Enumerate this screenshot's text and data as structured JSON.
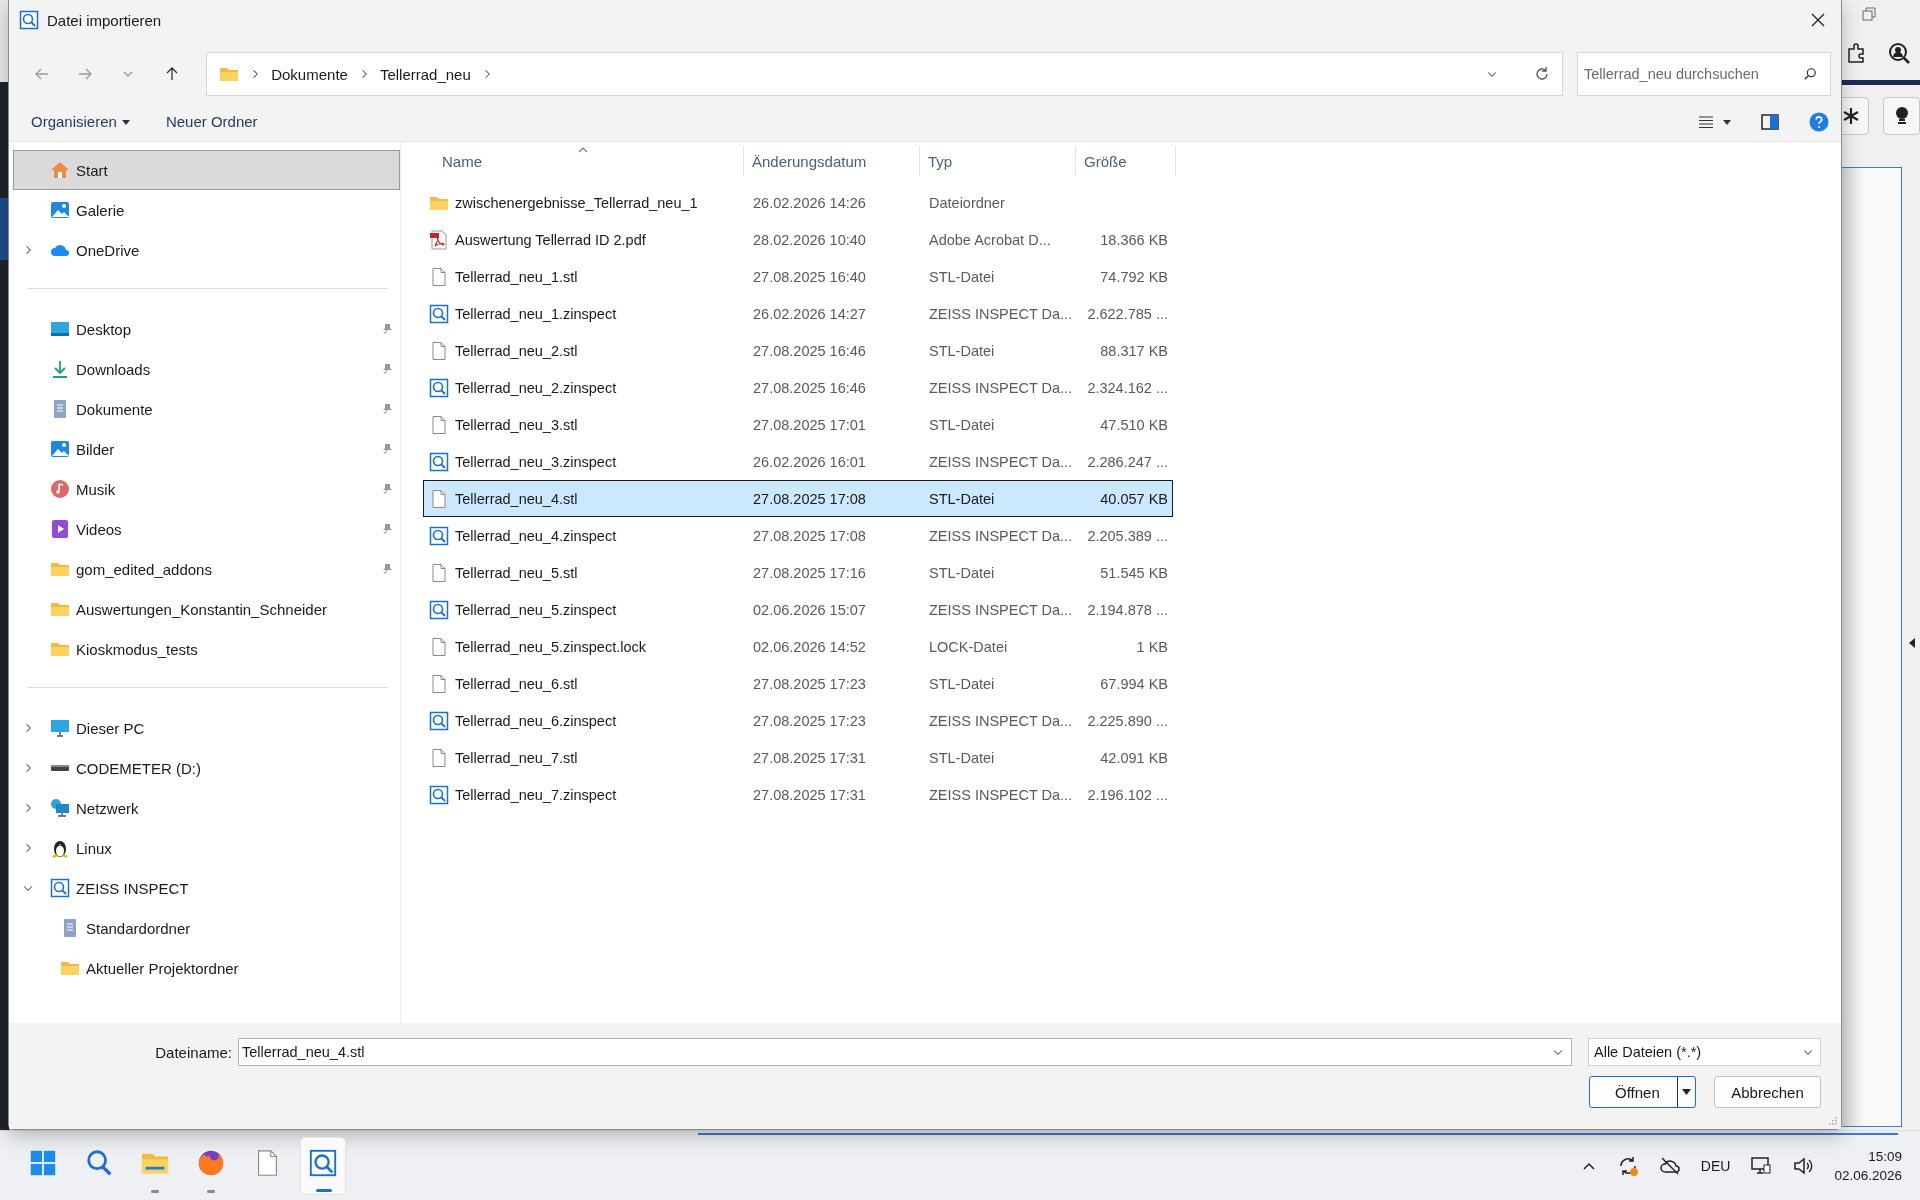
{
  "window": {
    "title": "Datei importieren"
  },
  "address": {
    "path": [
      "Dokumente",
      "Tellerrad_neu"
    ]
  },
  "search": {
    "placeholder": "Tellerrad_neu durchsuchen"
  },
  "commands": [
    {
      "label": "Organisieren",
      "dropdown": true
    },
    {
      "label": "Neuer Ordner",
      "dropdown": false
    }
  ],
  "sidebar": {
    "groups": [
      {
        "items": [
          {
            "label": "Start",
            "kind": "home",
            "selected": true
          },
          {
            "label": "Galerie",
            "kind": "gallery",
            "selected": false
          },
          {
            "label": "OneDrive",
            "kind": "cloud",
            "selected": false,
            "expanded": false
          }
        ]
      },
      {
        "items": [
          {
            "label": "Desktop",
            "kind": "desktop",
            "selected": false,
            "pinned": true
          },
          {
            "label": "Downloads",
            "kind": "download",
            "selected": false,
            "pinned": true
          },
          {
            "label": "Dokumente",
            "kind": "document",
            "selected": false,
            "pinned": true
          },
          {
            "label": "Bilder",
            "kind": "gallery",
            "selected": false,
            "pinned": true
          },
          {
            "label": "Musik",
            "kind": "music",
            "selected": false,
            "pinned": true
          },
          {
            "label": "Videos",
            "kind": "video",
            "selected": false,
            "pinned": true
          },
          {
            "label": "gom_edited_addons",
            "kind": "folder",
            "selected": false,
            "pinned": true
          },
          {
            "label": "Auswertungen_Konstantin_Schneider",
            "kind": "folder",
            "selected": false,
            "pinned": false
          },
          {
            "label": "Kioskmodus_tests",
            "kind": "folder",
            "selected": false,
            "pinned": false
          }
        ]
      },
      {
        "items": [
          {
            "label": "Dieser PC",
            "kind": "pc",
            "selected": false,
            "expanded": false
          },
          {
            "label": "CODEMETER (D:)",
            "kind": "drive",
            "selected": false,
            "expanded": false
          },
          {
            "label": "Netzwerk",
            "kind": "network",
            "selected": false,
            "expanded": false
          },
          {
            "label": "Linux",
            "kind": "linux",
            "selected": false,
            "expanded": false
          },
          {
            "label": "ZEISS INSPECT",
            "kind": "zinspect",
            "selected": false,
            "expanded": true,
            "children": [
              {
                "label": "Standardordner",
                "kind": "document",
                "selected": false
              },
              {
                "label": "Aktueller Projektordner",
                "kind": "folder",
                "selected": false
              }
            ]
          }
        ]
      }
    ]
  },
  "table": {
    "columns": [
      {
        "label": "Name",
        "sorted": true
      },
      {
        "label": "Änderungsdatum",
        "sorted": false
      },
      {
        "label": "Typ",
        "sorted": false
      },
      {
        "label": "Größe",
        "sorted": false
      }
    ],
    "rows": [
      {
        "kind": "folder",
        "name": "zwischenergebnisse_Tellerrad_neu_1",
        "date": "26.02.2026 14:26",
        "type": "Dateiordner",
        "size": "",
        "selected": false
      },
      {
        "kind": "pdf",
        "name": "Auswertung Tellerrad ID 2.pdf",
        "date": "28.02.2026 10:40",
        "type": "Adobe Acrobat D...",
        "size": "18.366 KB",
        "selected": false
      },
      {
        "kind": "file",
        "name": "Tellerrad_neu_1.stl",
        "date": "27.08.2025 16:40",
        "type": "STL-Datei",
        "size": "74.792 KB",
        "selected": false
      },
      {
        "kind": "zinspect",
        "name": "Tellerrad_neu_1.zinspect",
        "date": "26.02.2026 14:27",
        "type": "ZEISS INSPECT Da...",
        "size": "2.622.785 ...",
        "selected": false
      },
      {
        "kind": "file",
        "name": "Tellerrad_neu_2.stl",
        "date": "27.08.2025 16:46",
        "type": "STL-Datei",
        "size": "88.317 KB",
        "selected": false
      },
      {
        "kind": "zinspect",
        "name": "Tellerrad_neu_2.zinspect",
        "date": "27.08.2025 16:46",
        "type": "ZEISS INSPECT Da...",
        "size": "2.324.162 ...",
        "selected": false
      },
      {
        "kind": "file",
        "name": "Tellerrad_neu_3.stl",
        "date": "27.08.2025 17:01",
        "type": "STL-Datei",
        "size": "47.510 KB",
        "selected": false
      },
      {
        "kind": "zinspect",
        "name": "Tellerrad_neu_3.zinspect",
        "date": "26.02.2026 16:01",
        "type": "ZEISS INSPECT Da...",
        "size": "2.286.247 ...",
        "selected": false
      },
      {
        "kind": "file",
        "name": "Tellerrad_neu_4.stl",
        "date": "27.08.2025 17:08",
        "type": "STL-Datei",
        "size": "40.057 KB",
        "selected": true
      },
      {
        "kind": "zinspect",
        "name": "Tellerrad_neu_4.zinspect",
        "date": "27.08.2025 17:08",
        "type": "ZEISS INSPECT Da...",
        "size": "2.205.389 ...",
        "selected": false
      },
      {
        "kind": "file",
        "name": "Tellerrad_neu_5.stl",
        "date": "27.08.2025 17:16",
        "type": "STL-Datei",
        "size": "51.545 KB",
        "selected": false
      },
      {
        "kind": "zinspect",
        "name": "Tellerrad_neu_5.zinspect",
        "date": "02.06.2026 15:07",
        "type": "ZEISS INSPECT Da...",
        "size": "2.194.878 ...",
        "selected": false
      },
      {
        "kind": "file",
        "name": "Tellerrad_neu_5.zinspect.lock",
        "date": "02.06.2026 14:52",
        "type": "LOCK-Datei",
        "size": "1 KB",
        "selected": false
      },
      {
        "kind": "file",
        "name": "Tellerrad_neu_6.stl",
        "date": "27.08.2025 17:23",
        "type": "STL-Datei",
        "size": "67.994 KB",
        "selected": false
      },
      {
        "kind": "zinspect",
        "name": "Tellerrad_neu_6.zinspect",
        "date": "27.08.2025 17:23",
        "type": "ZEISS INSPECT Da...",
        "size": "2.225.890 ...",
        "selected": false
      },
      {
        "kind": "file",
        "name": "Tellerrad_neu_7.stl",
        "date": "27.08.2025 17:31",
        "type": "STL-Datei",
        "size": "42.091 KB",
        "selected": false
      },
      {
        "kind": "zinspect",
        "name": "Tellerrad_neu_7.zinspect",
        "date": "27.08.2025 17:31",
        "type": "ZEISS INSPECT Da...",
        "size": "2.196.102 ...",
        "selected": false
      }
    ]
  },
  "file_name": {
    "label": "Dateiname:",
    "value": "Tellerrad_neu_4.stl"
  },
  "file_type": {
    "value": "Alle Dateien (*.*)"
  },
  "buttons": [
    {
      "label": "Öffnen",
      "kind": "split",
      "default": true
    },
    {
      "label": "Abbrechen",
      "kind": "plain",
      "default": false
    }
  ],
  "taskbar": {
    "apps": [
      {
        "kind": "start",
        "running": false,
        "active": false
      },
      {
        "kind": "search",
        "running": false,
        "active": false
      },
      {
        "kind": "explorer",
        "running": true,
        "active": false
      },
      {
        "kind": "browser",
        "running": true,
        "active": false
      },
      {
        "kind": "file",
        "running": false,
        "active": false
      },
      {
        "kind": "zinspect",
        "running": true,
        "active": true
      }
    ],
    "language": "DEU",
    "time": "15:09",
    "date": "02.06.2026"
  }
}
